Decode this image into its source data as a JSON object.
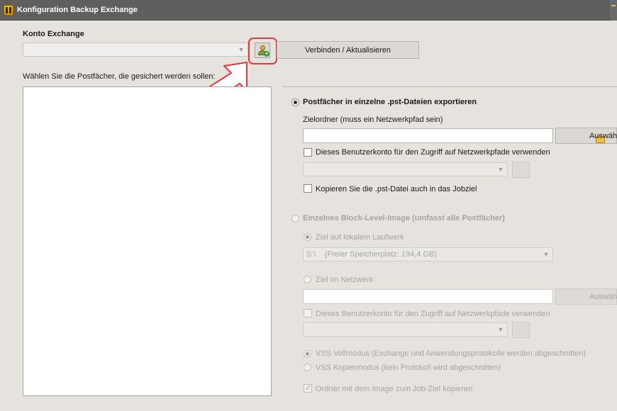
{
  "window": {
    "title": "Konfiguration Backup Exchange"
  },
  "account": {
    "heading": "Konto Exchange",
    "combo_value": "",
    "add_user_icon": "add-user-icon",
    "connect_button": "Verbinden / Aktualisieren"
  },
  "mailboxes": {
    "label": "Wählen Sie die Postfächer, die gesichert werden sollen:",
    "items": []
  },
  "pst_export": {
    "option_label": "Postfächer in einzelne .pst-Dateien exportieren",
    "selected": true,
    "target_folder_label": "Zielordner (muss ein Netzwerkpfad sein)",
    "target_folder_value": "",
    "browse_button": "Auswäh",
    "use_account_label": "Dieses Benutzerkonto für den Zugriff auf Netzwerkpfade verwenden",
    "use_account_checked": false,
    "account_combo_value": "",
    "copy_pst_label": "Kopieren Sie die .pst-Datei auch in das Jobziel",
    "copy_pst_checked": false
  },
  "block_image": {
    "option_label": "Einzelnes Block-Level-Image (umfasst alle Postfächer)",
    "selected": false,
    "local_target_label": "Ziel auf lokalem Laufwerk",
    "local_target_selected": true,
    "drive_value": "S:\\    (Freier Speicherplatz: 194,4 GB)",
    "network_target_label": "Ziel im Netzwerk",
    "network_target_selected": false,
    "network_path_value": "",
    "browse_button": "Auswäh",
    "use_account_label": "Dieses Benutzerkonto für den Zugriff auf Netzwerkpfade verwenden",
    "use_account_checked": false,
    "account_combo_value": "",
    "vss_full_label": "VSS Vollmodus (Exchange und Anwendungsprotokolle werden abgeschnitten)",
    "vss_full_selected": true,
    "vss_copy_label": "VSS Kopiermodus (kein Protokoll wird abgeschnitten)",
    "vss_copy_selected": false,
    "copy_folder_label": "Ordner mit dem Image zum Job-Ziel kopieren",
    "copy_folder_checked": true
  },
  "colors": {
    "highlight": "#e23a3a",
    "arrow_fill": "#ffffff",
    "arrow_stroke": "#e23a3a"
  }
}
